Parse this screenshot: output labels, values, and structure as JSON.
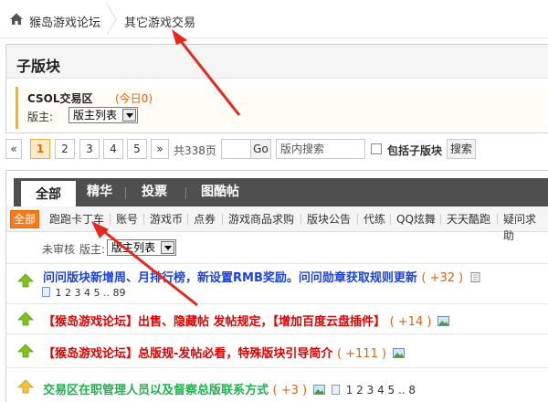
{
  "breadcrumb": {
    "home_icon": "home-icon",
    "forum": "猴岛游戏论坛",
    "board": "其它游戏交易"
  },
  "subforum": {
    "heading": "子版块",
    "name": "CSOL交易区",
    "today": "(今日0)",
    "moderator_label": "版主:",
    "moderator_select": "版主列表"
  },
  "pager": {
    "prev": "«",
    "pages": [
      "1",
      "2",
      "3",
      "4",
      "5"
    ],
    "current": "1",
    "next": "»",
    "total": "共338页",
    "go": "Go",
    "search_placeholder": "版内搜索",
    "include_sub_label": "包括子版块",
    "search_button": "搜索"
  },
  "tabs": [
    "全部",
    "精华",
    "投票",
    "图酷帖"
  ],
  "categories": [
    "全部",
    "跑跑卡丁车",
    "账号",
    "游戏币",
    "点券",
    "游戏商品求购",
    "版块公告",
    "代练",
    "QQ炫舞",
    "天天酷跑",
    "疑问求助"
  ],
  "filter": {
    "unreviewed": "未审核",
    "moderator_label": "版主:",
    "moderator_select": "版主列表"
  },
  "threads": [
    {
      "title": "问问版块新增周、月排行榜，新设置RMB奖励。问问勋章获取规则更新",
      "hot": "( +32 )",
      "color": "#1c43d8",
      "attach": "file-icon",
      "pages": "1 2 3 4 5 .. 89"
    },
    {
      "title": "【猴岛游戏论坛】出售、隐藏帖 发帖规定，【增加百度云盘插件】",
      "hot": "( +14 )",
      "color": "#e20000",
      "attach": "image-icon",
      "pages": ""
    },
    {
      "title": "【猴岛游戏论坛】总版规-发帖必看，特殊版块引导简介",
      "hot": "( +111 )",
      "color": "#e20000",
      "attach": "image-icon",
      "pages": ""
    },
    {
      "title": "交易区在职管理人员以及督察总版联系方式",
      "hot": "( +3 )",
      "color": "#21b04d",
      "attach": "image-icon",
      "pages": "1 2 3 4 5 .. 8"
    }
  ],
  "annotation_arrows_color": "#e8261c"
}
